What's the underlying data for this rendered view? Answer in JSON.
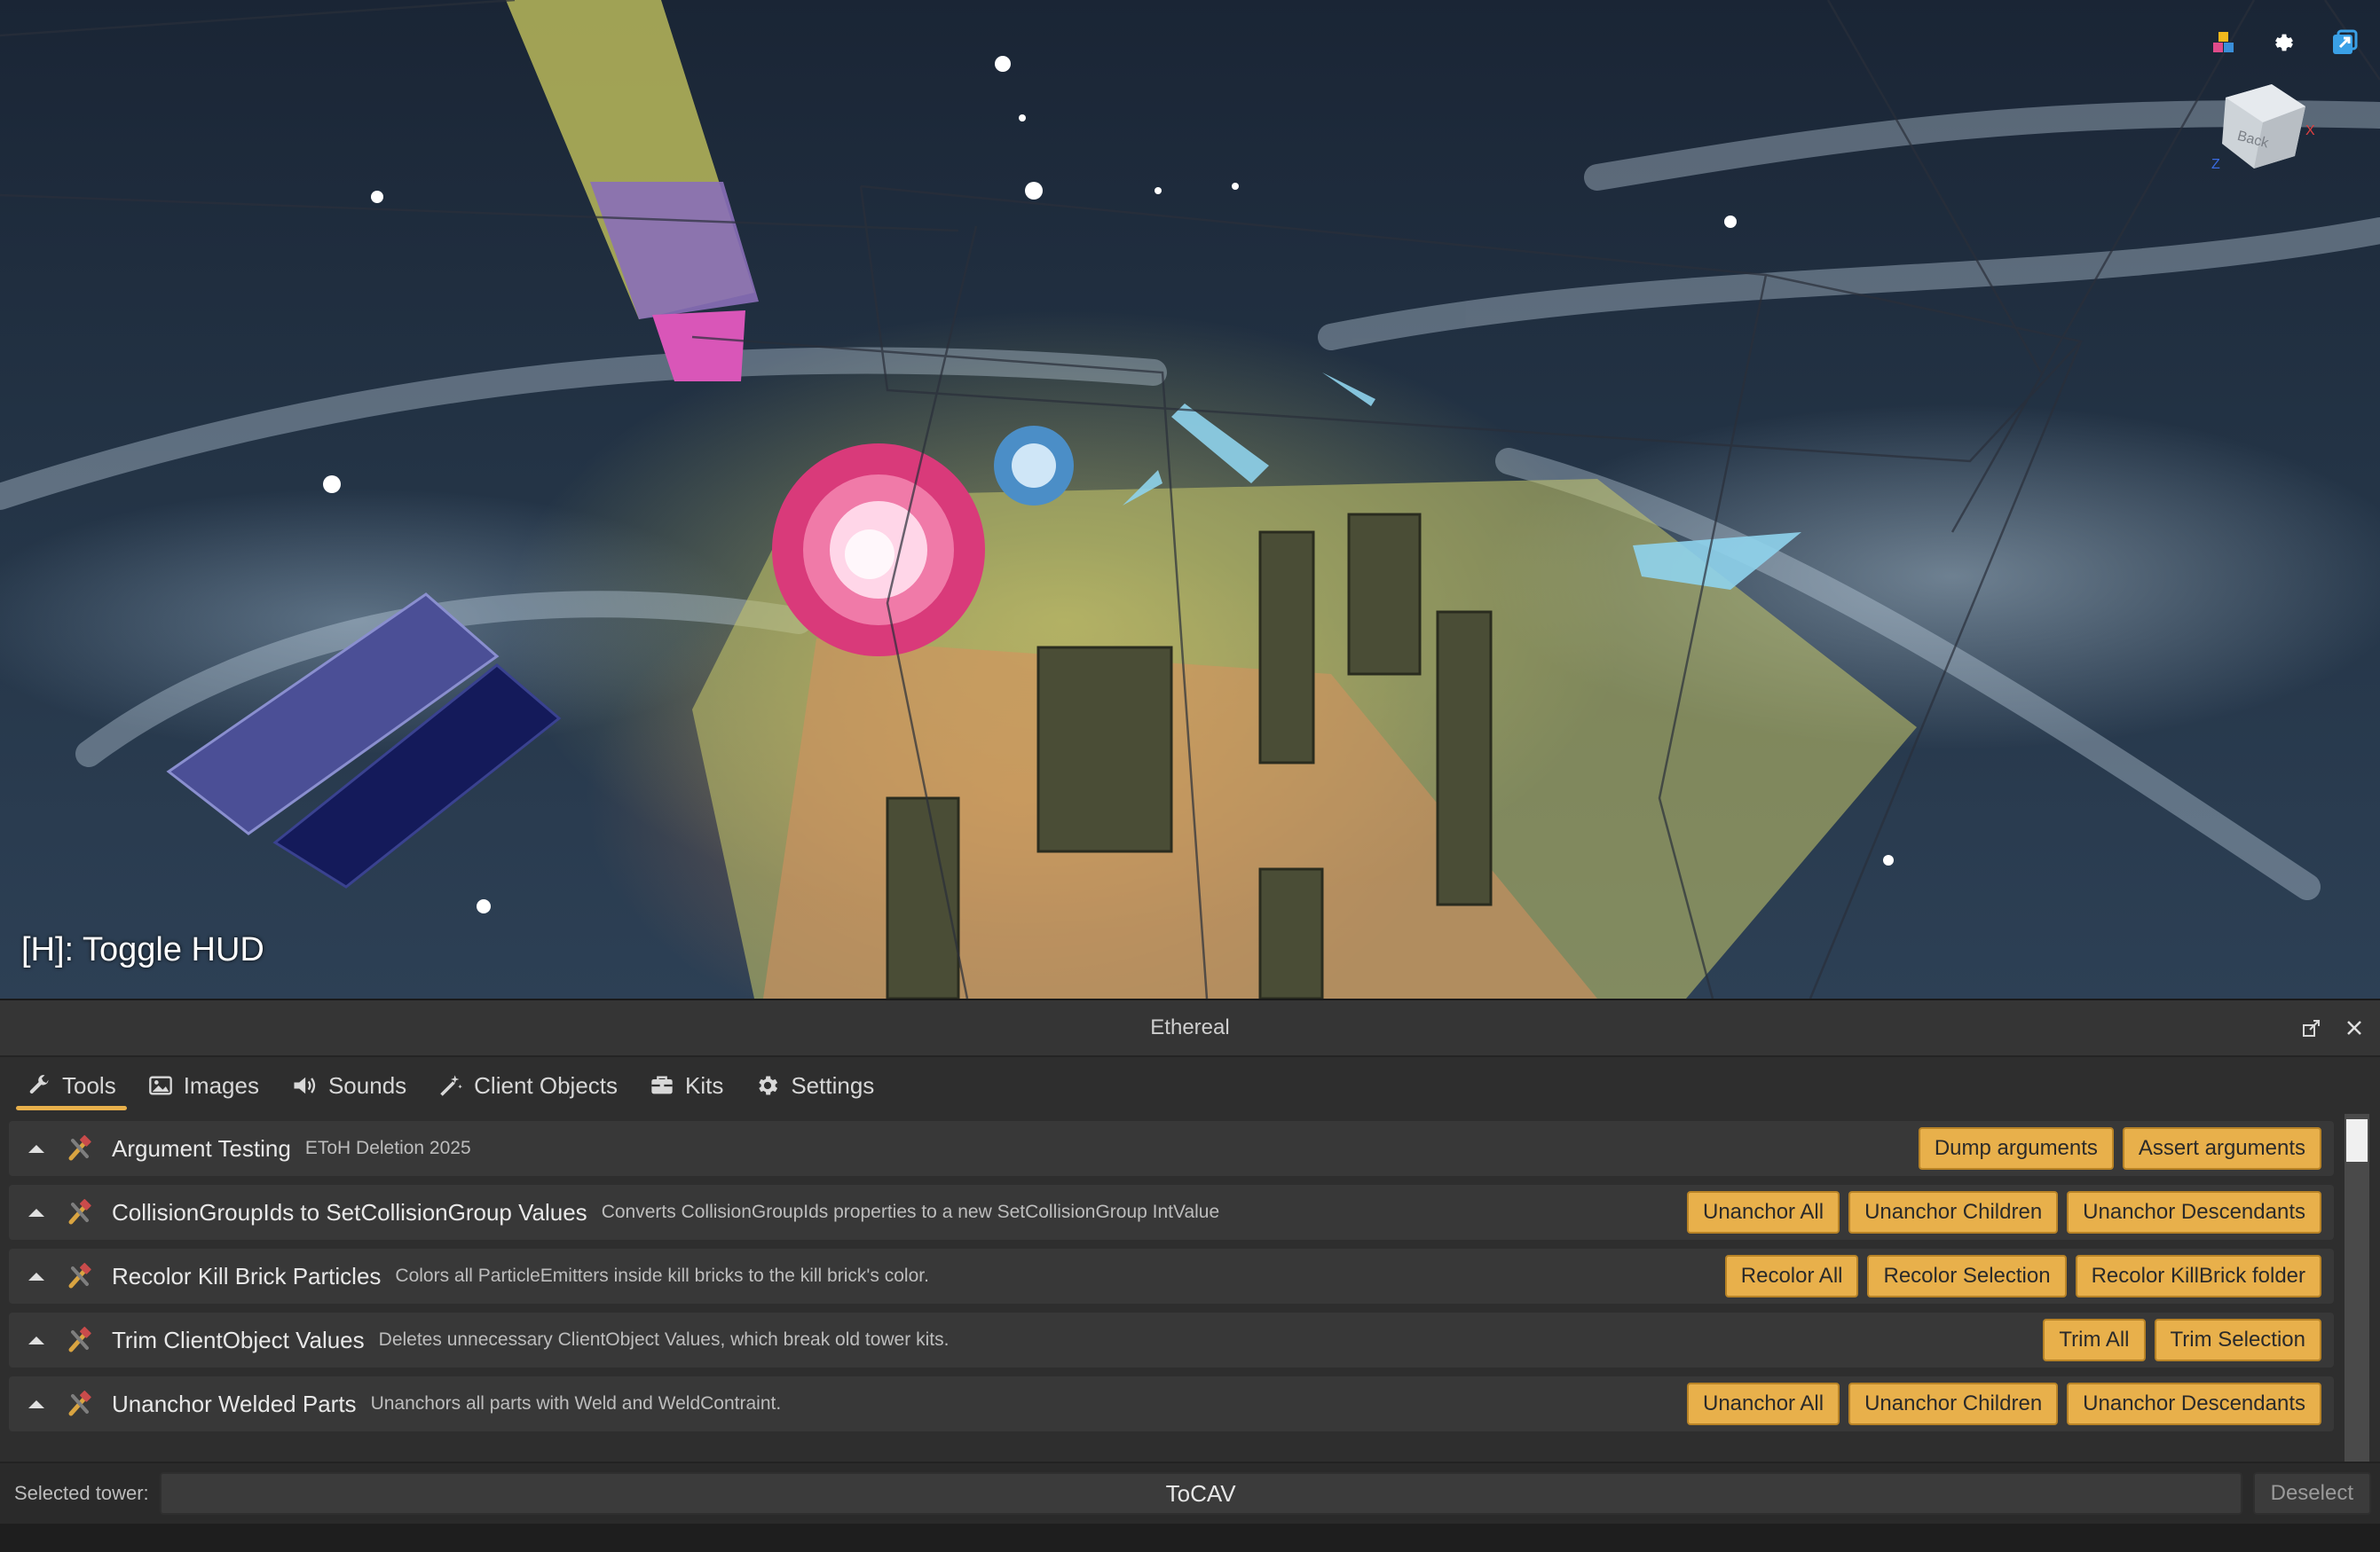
{
  "viewport": {
    "hud_hint": "[H]: Toggle HUD",
    "view_cube_label": "Back",
    "icons": [
      "color-squares-icon",
      "gear-icon",
      "window-expand-icon"
    ]
  },
  "panel": {
    "title": "Ethereal",
    "title_buttons": [
      "pop-out-icon",
      "close-icon"
    ]
  },
  "tabs": [
    {
      "label": "Tools",
      "icon": "wrench-icon",
      "active": true
    },
    {
      "label": "Images",
      "icon": "image-icon",
      "active": false
    },
    {
      "label": "Sounds",
      "icon": "speaker-icon",
      "active": false
    },
    {
      "label": "Client Objects",
      "icon": "magic-wand-icon",
      "active": false
    },
    {
      "label": "Kits",
      "icon": "toolbox-icon",
      "active": false
    },
    {
      "label": "Settings",
      "icon": "gear-icon",
      "active": false
    }
  ],
  "tools": [
    {
      "title": "Argument Testing",
      "desc": "EToH Deletion 2025",
      "buttons": [
        "Dump arguments",
        "Assert arguments"
      ]
    },
    {
      "title": "CollisionGroupIds to SetCollisionGroup Values",
      "desc": "Converts CollisionGroupIds properties to a new SetCollisionGroup IntValue",
      "buttons": [
        "Unanchor All",
        "Unanchor Children",
        "Unanchor Descendants"
      ]
    },
    {
      "title": "Recolor Kill Brick Particles",
      "desc": "Colors all ParticleEmitters inside kill bricks to the kill brick's color.",
      "buttons": [
        "Recolor All",
        "Recolor Selection",
        "Recolor KillBrick folder"
      ]
    },
    {
      "title": "Trim ClientObject Values",
      "desc": "Deletes unnecessary ClientObject Values, which break old tower kits.",
      "buttons": [
        "Trim All",
        "Trim Selection"
      ]
    },
    {
      "title": "Unanchor Welded Parts",
      "desc": "Unanchors all parts with Weld and WeldContraint.",
      "buttons": [
        "Unanchor All",
        "Unanchor Children",
        "Unanchor Descendants"
      ]
    }
  ],
  "footer": {
    "label": "Selected tower:",
    "value": "ToCAV",
    "deselect": "Deselect"
  },
  "colors": {
    "accent": "#e8b04b",
    "panel_bg": "#2e2e2e",
    "row_bg": "#383838"
  }
}
